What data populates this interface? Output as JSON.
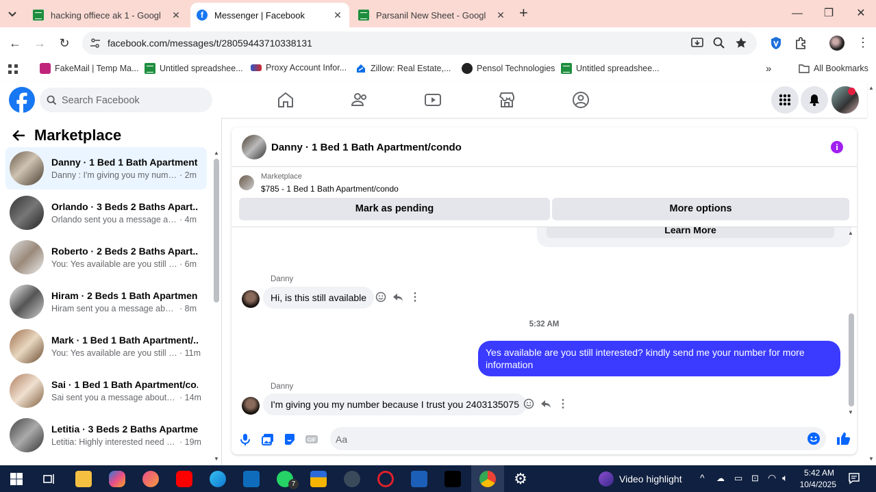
{
  "browser": {
    "tabs": [
      {
        "title": "hacking offiece ak 1 - Google Sh",
        "icon": "sheets-icon"
      },
      {
        "title": "Messenger | Facebook",
        "icon": "facebook-icon"
      },
      {
        "title": "Parsanil New Sheet - Google Sh",
        "icon": "sheets-icon"
      }
    ],
    "url": "facebook.com/messages/t/28059443710338131",
    "bookmarks": [
      {
        "label": "FakeMail | Temp Ma...",
        "icon": "fakemail-icon"
      },
      {
        "label": "Untitled spreadshee...",
        "icon": "sheets-icon"
      },
      {
        "label": "Proxy Account Infor...",
        "icon": "proxy-icon"
      },
      {
        "label": "Zillow: Real Estate,...",
        "icon": "zillow-icon"
      },
      {
        "label": "Pensol Technologies",
        "icon": "pensol-icon"
      },
      {
        "label": "Untitled spreadshee...",
        "icon": "sheets-icon"
      }
    ],
    "all_bookmarks": "All Bookmarks"
  },
  "facebook": {
    "search_placeholder": "Search Facebook",
    "panel_title": "Marketplace",
    "threads": [
      {
        "name": "Danny · 1 Bed 1 Bath Apartment...",
        "preview": "Danny : I'm giving you my number...",
        "time": "· 2m",
        "selected": true
      },
      {
        "name": "Orlando · 3 Beds 2 Baths Apart...",
        "preview": "Orlando sent you a message abou...",
        "time": "· 4m"
      },
      {
        "name": "Roberto · 2 Beds 2 Baths Apart...",
        "preview": "You: Yes available are you still inter...",
        "time": "· 6m"
      },
      {
        "name": "Hiram · 2 Beds 1 Bath Apartmen...",
        "preview": "Hiram sent you a message about y...",
        "time": "· 8m"
      },
      {
        "name": "Mark · 1 Bed 1 Bath Apartment/...",
        "preview": "You: Yes available are you still int...",
        "time": "· 11m"
      },
      {
        "name": "Sai · 1 Bed 1 Bath Apartment/co...",
        "preview": "Sai sent you a message about yo...",
        "time": "· 14m"
      },
      {
        "name": "Letitia · 3 Beds 2 Baths Apartme...",
        "preview": "Letitia: Highly interested need to ...",
        "time": "· 19m"
      }
    ],
    "conversation": {
      "title": "Danny · 1 Bed 1 Bath Apartment/condo",
      "listing_label": "Marketplace",
      "listing_price": "$785 - 1 Bed 1 Bath Apartment/condo",
      "mark_pending": "Mark as pending",
      "more_options": "More options",
      "learn_more": "Learn More",
      "messages": [
        {
          "sender": "Danny",
          "text": "Hi, is this still available"
        },
        {
          "timestamp": "5:32 AM"
        },
        {
          "text": "Yes available are you still interested? kindly send me your number for more information"
        },
        {
          "sender": "Danny",
          "text": "I'm giving you my number because I trust you 2403135075"
        }
      ],
      "composer_placeholder": "Aa"
    }
  },
  "taskbar": {
    "video_highlight": "Video highlight",
    "time": "5:42 AM",
    "date": "10/4/2025",
    "whatsapp_badge": "7"
  },
  "colors": {
    "facebook_blue": "#1877f2",
    "outgoing_bubble": "#3a3bff",
    "tab_strip": "#fbdad4",
    "taskbar": "#0f2040"
  }
}
